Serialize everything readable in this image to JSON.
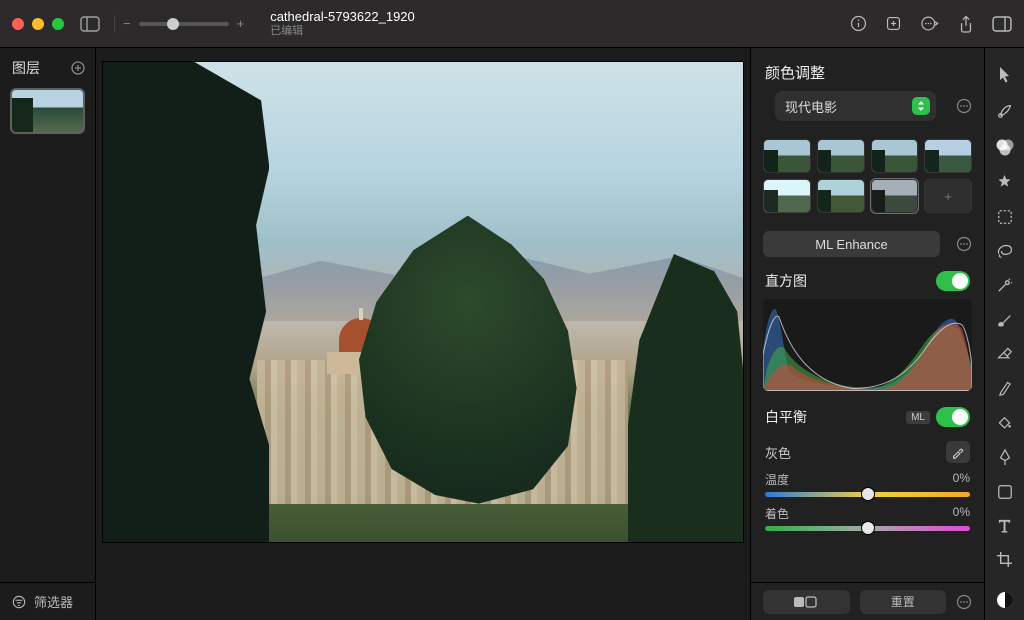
{
  "titlebar": {
    "filename": "cathedral-5793622_1920",
    "subtitle": "已编辑"
  },
  "layers": {
    "title": "图层",
    "filter": "筛选器"
  },
  "inspector": {
    "title": "颜色调整",
    "preset_name": "现代电影",
    "ml_enhance": "ML Enhance",
    "histogram_title": "直方图",
    "white_balance_title": "白平衡",
    "ml_badge": "ML",
    "gray_label": "灰色",
    "temp": {
      "label": "温度",
      "value": "0%",
      "pos": 50
    },
    "tint": {
      "label": "着色",
      "value": "0%",
      "pos": 50
    },
    "reset": "重置"
  }
}
